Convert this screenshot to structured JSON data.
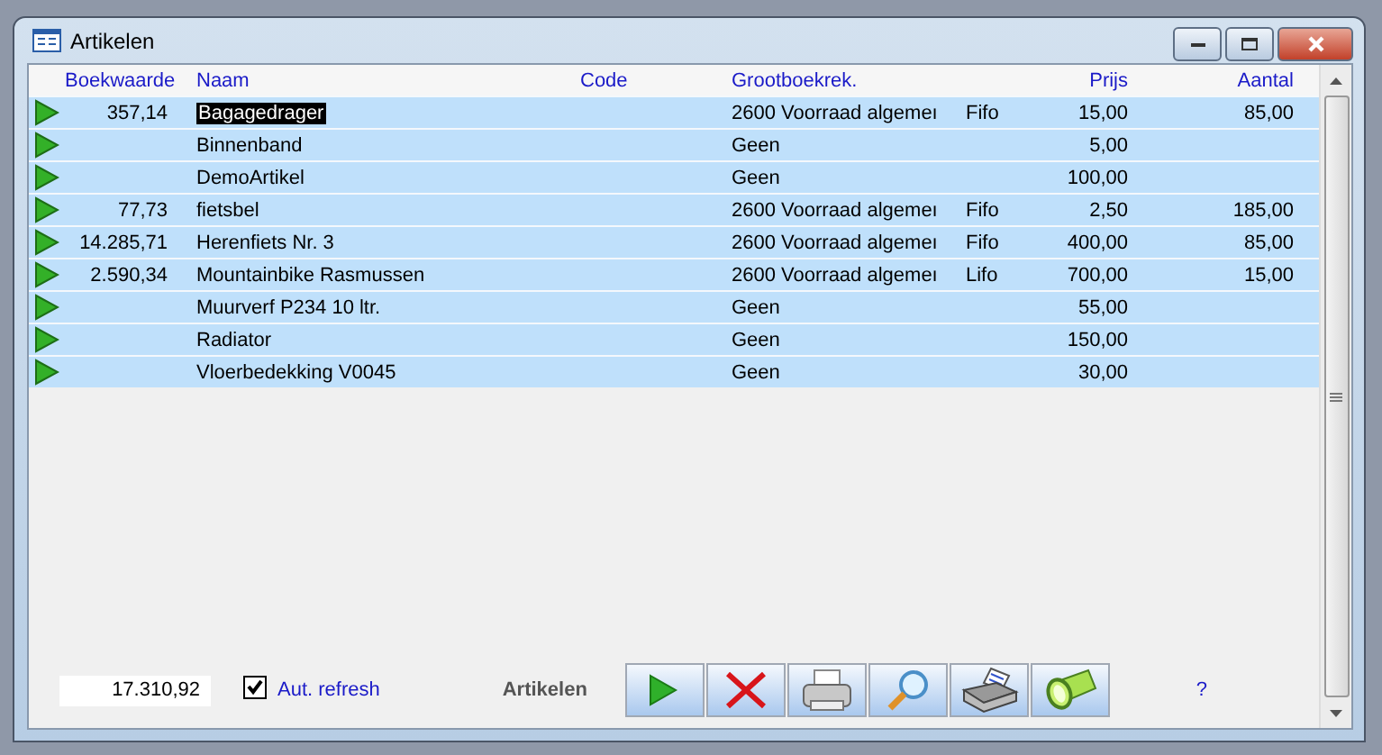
{
  "window": {
    "title": "Artikelen"
  },
  "table": {
    "columns": [
      "Boekwaarde",
      "Naam",
      "Code",
      "Grootboekrek.",
      "",
      "Prijs",
      "Aantal"
    ],
    "rows": [
      {
        "selected": true,
        "boekwaarde": "357,14",
        "naam": "Bagagedrager",
        "grootboekrek": "2600 Voorraad algemeı",
        "column_5": "Fifo",
        "prijs": "15,00",
        "aantal": "85,00"
      },
      {
        "selected": false,
        "naam": "Binnenband",
        "grootboekrek": "Geen",
        "prijs": "5,00"
      },
      {
        "selected": false,
        "naam": "DemoArtikel",
        "grootboekrek": "Geen",
        "prijs": "100,00"
      },
      {
        "selected": false,
        "boekwaarde": "77,73",
        "naam": "fietsbel",
        "grootboekrek": "2600 Voorraad algemeı",
        "column_5": "Fifo",
        "prijs": "2,50",
        "aantal": "185,00"
      },
      {
        "selected": false,
        "boekwaarde": "14.285,71",
        "naam": "Herenfiets Nr. 3",
        "grootboekrek": "2600 Voorraad algemeı",
        "column_5": "Fifo",
        "prijs": "400,00",
        "aantal": "85,00"
      },
      {
        "selected": false,
        "boekwaarde": "2.590,34",
        "naam": "Mountainbike Rasmussen",
        "grootboekrek": "2600 Voorraad algemeı",
        "column_5": "Lifo",
        "prijs": "700,00",
        "aantal": "15,00"
      },
      {
        "selected": false,
        "naam": "Muurverf P234 10 ltr.",
        "grootboekrek": "Geen",
        "prijs": "55,00"
      },
      {
        "selected": false,
        "naam": "Radiator",
        "grootboekrek": "Geen",
        "prijs": "150,00"
      },
      {
        "selected": false,
        "naam": "Vloerbedekking V0045",
        "grootboekrek": "Geen",
        "prijs": "30,00"
      }
    ]
  },
  "footer": {
    "total": "17.310,92",
    "auto_refresh": {
      "label": "Aut. refresh",
      "checked": true
    },
    "label": "Artikelen",
    "buttons": [
      {
        "kind": "play"
      },
      {
        "kind": "delete"
      },
      {
        "kind": "print"
      },
      {
        "kind": "search"
      },
      {
        "kind": "fax"
      },
      {
        "kind": "flashlight"
      }
    ],
    "help": "?"
  }
}
